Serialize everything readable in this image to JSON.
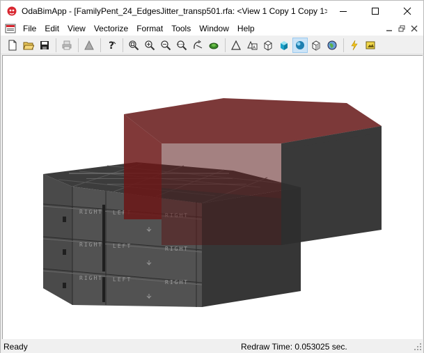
{
  "window": {
    "title": "OdaBimApp - [FamilyPent_24_EdgesJitter_transp501.rfa: <View 1 Copy 1 Copy 1> ..."
  },
  "menu": {
    "items": [
      "File",
      "Edit",
      "View",
      "Vectorize",
      "Format",
      "Tools",
      "Window",
      "Help"
    ]
  },
  "toolbar": {
    "buttons": [
      {
        "name": "new-icon"
      },
      {
        "name": "open-icon"
      },
      {
        "name": "save-icon"
      },
      {
        "name": "print-icon"
      },
      {
        "name": "render-icon"
      },
      {
        "name": "help-icon"
      },
      {
        "name": "zoom-extents-icon"
      },
      {
        "name": "zoom-in-icon"
      },
      {
        "name": "zoom-out-icon"
      },
      {
        "name": "zoom-window-icon"
      },
      {
        "name": "orbit-icon"
      },
      {
        "name": "pan-icon"
      },
      {
        "name": "wireframe-icon"
      },
      {
        "name": "hidden-line-icon"
      },
      {
        "name": "flat-shaded-icon"
      },
      {
        "name": "gouraud-shaded-icon"
      },
      {
        "name": "smooth-shaded-icon"
      },
      {
        "name": "box-icon"
      },
      {
        "name": "globe-icon"
      },
      {
        "name": "lightning-icon"
      },
      {
        "name": "image-icon"
      }
    ],
    "active": "smooth-shaded-icon"
  },
  "model_labels": {
    "right": "RIGHT",
    "left": "LEFT"
  },
  "status": {
    "left": "Ready",
    "right": "Redraw Time: 0.053025 sec."
  },
  "colors": {
    "accent_active": "#cce4f7",
    "transparent_solid": "#6b1f1f",
    "grey_solid": "#3a3a3a"
  }
}
